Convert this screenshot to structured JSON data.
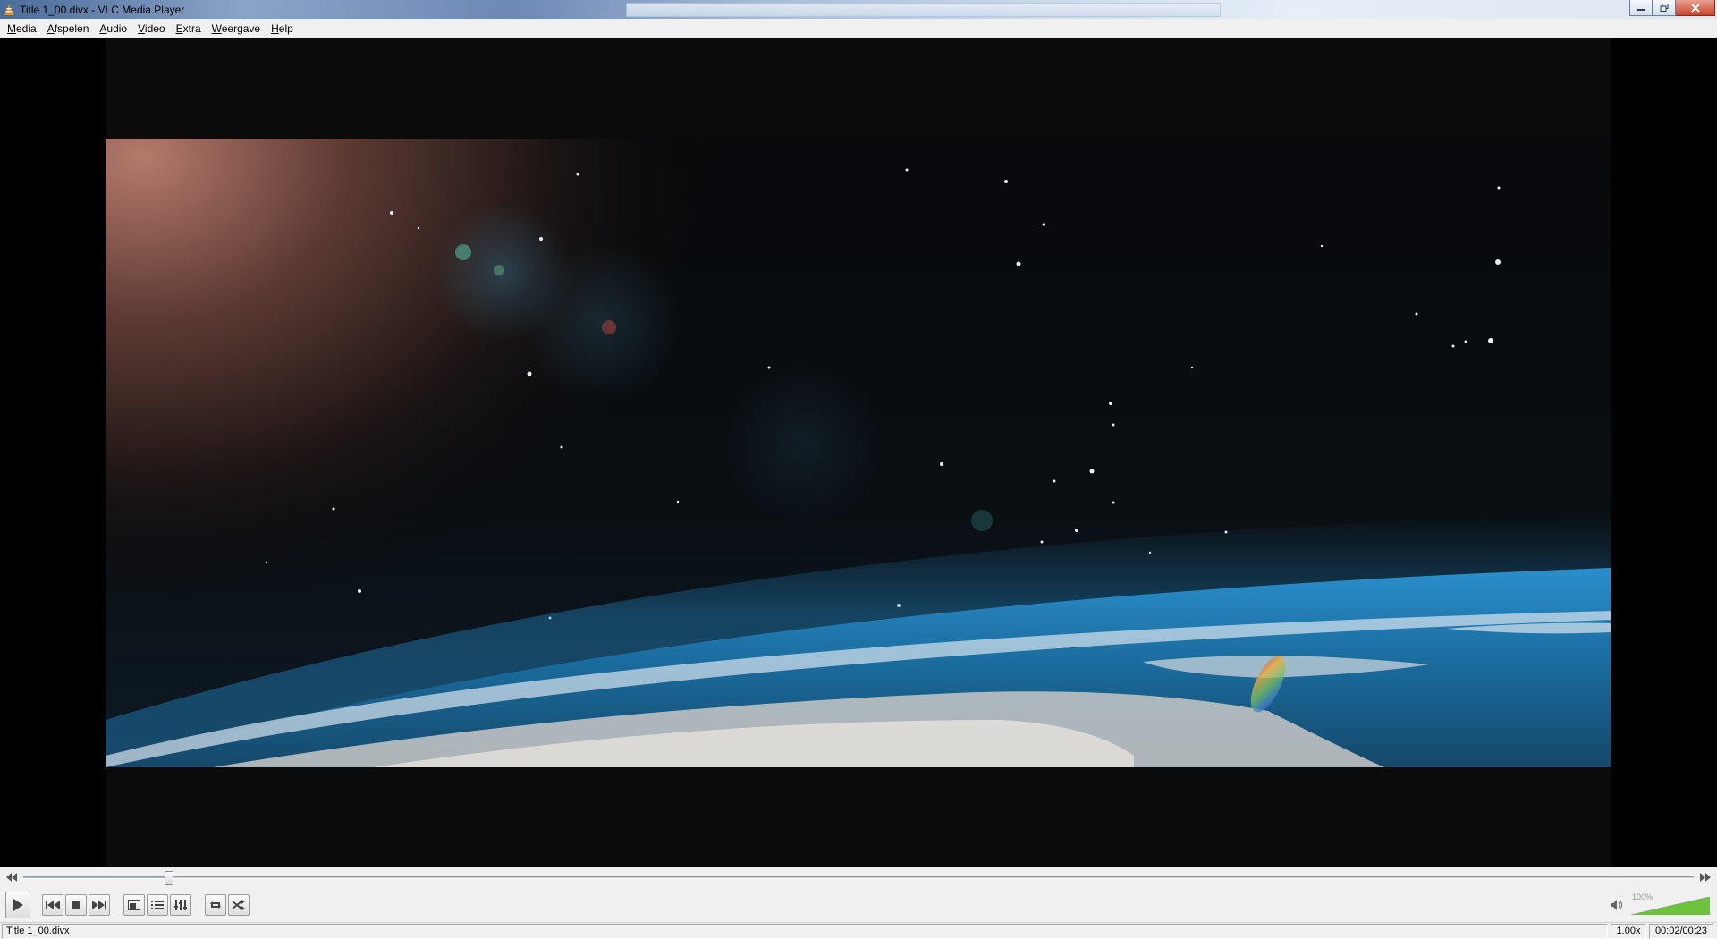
{
  "window": {
    "title": "Title 1_00.divx - VLC Media Player",
    "icon": "vlc-cone-icon"
  },
  "menu": {
    "items": [
      {
        "label": "Media"
      },
      {
        "label": "Afspelen"
      },
      {
        "label": "Audio"
      },
      {
        "label": "Video"
      },
      {
        "label": "Extra"
      },
      {
        "label": "Weergave"
      },
      {
        "label": "Help"
      }
    ]
  },
  "playback": {
    "progress_fraction": 0.087
  },
  "volume": {
    "label": "100%",
    "level_fraction": 1.0
  },
  "status": {
    "filename": "Title 1_00.divx",
    "speed": "1.00x",
    "time": "00:02/00:23"
  },
  "colors": {
    "accent_volume": "#6cc23a",
    "window_bg": "#f0f0f0"
  }
}
